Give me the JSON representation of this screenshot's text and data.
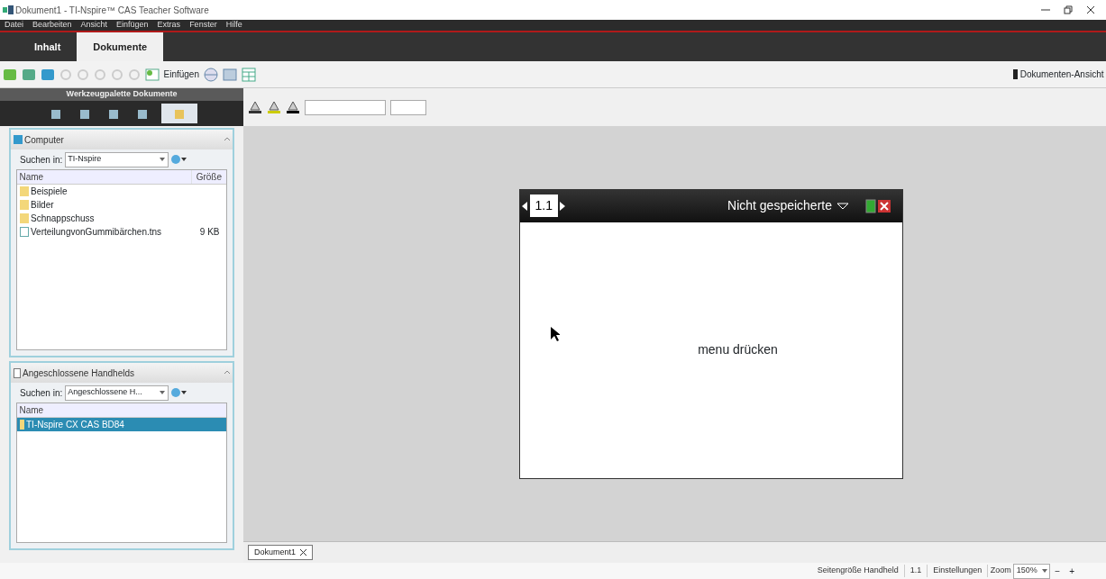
{
  "window": {
    "title": "Dokument1 - TI-Nspire™ CAS Teacher Software"
  },
  "menu": [
    "Datei",
    "Bearbeiten",
    "Ansicht",
    "Einfügen",
    "Extras",
    "Fenster",
    "Hilfe"
  ],
  "tabs": [
    {
      "label": "Inhalt",
      "selected": false
    },
    {
      "label": "Dokumente",
      "selected": true
    }
  ],
  "toolbar": {
    "insert_label": "Einfügen",
    "view_button": "Dokumenten-Ansicht"
  },
  "palette": {
    "title": "Werkzeugpalette Dokumente"
  },
  "computer_panel": {
    "title": "Computer",
    "search_label": "Suchen in:",
    "search_value": "TI-Nspire",
    "columns": [
      "Name",
      "Größe"
    ],
    "rows": [
      {
        "kind": "folder",
        "name": "Beispiele",
        "size": ""
      },
      {
        "kind": "folder",
        "name": "Bilder",
        "size": ""
      },
      {
        "kind": "folder",
        "name": "Schnappschuss",
        "size": ""
      },
      {
        "kind": "file",
        "name": "VerteilungvonGummibärchen.tns",
        "size": "9 KB"
      }
    ]
  },
  "handheld_panel": {
    "title": "Angeschlossene Handhelds",
    "search_label": "Suchen in:",
    "search_value": "Angeschlossene H...",
    "column": "Name",
    "rows": [
      {
        "name": "TI-Nspire CX CAS BD84",
        "selected": true
      }
    ]
  },
  "device": {
    "page": "1.1",
    "doc_title": "Nicht gespeicherte",
    "message": "menu drücken"
  },
  "doc_tabs": [
    {
      "label": "Dokument1",
      "selected": true
    }
  ],
  "status_bar": {
    "page_size": "Seitengröße Handheld",
    "page": "1.1",
    "settings": "Einstellungen",
    "zoom_label": "Zoom",
    "zoom_value": "150%",
    "zoom_out": "−",
    "zoom_in": "+"
  }
}
